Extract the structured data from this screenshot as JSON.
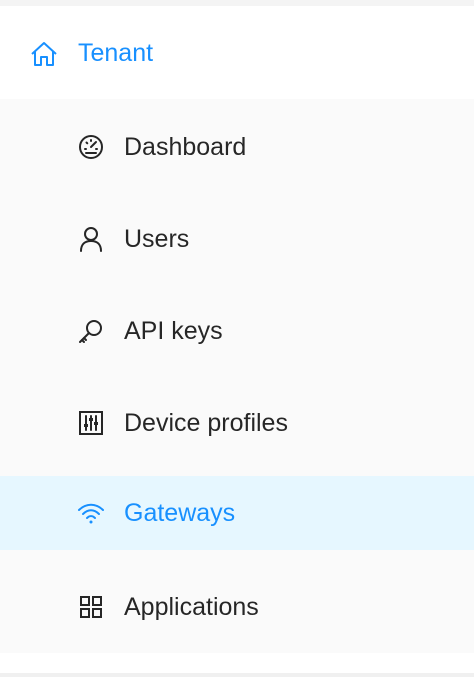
{
  "sidebar": {
    "header": {
      "label": "Tenant",
      "icon": "home-icon",
      "color": "#1890ff"
    },
    "items": [
      {
        "label": "Dashboard",
        "icon": "dashboard-gauge-icon",
        "selected": false
      },
      {
        "label": "Users",
        "icon": "user-icon",
        "selected": false
      },
      {
        "label": "API keys",
        "icon": "key-icon",
        "selected": false
      },
      {
        "label": "Device profiles",
        "icon": "sliders-icon",
        "selected": false
      },
      {
        "label": "Gateways",
        "icon": "wifi-icon",
        "selected": true
      },
      {
        "label": "Applications",
        "icon": "appstore-grid-icon",
        "selected": false
      }
    ],
    "colors": {
      "accent": "#1890ff",
      "selected_background": "#e6f7ff",
      "submenu_background": "#fafafa",
      "text": "#262626"
    }
  }
}
